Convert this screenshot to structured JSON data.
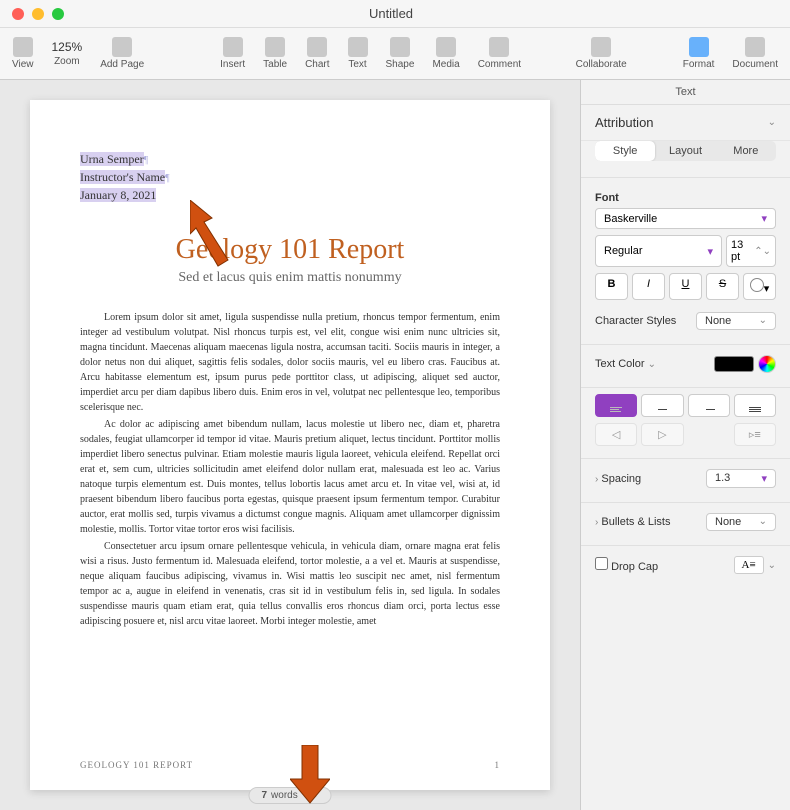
{
  "titlebar": {
    "title": "Untitled"
  },
  "toolbar": {
    "view": "View",
    "zoom": "Zoom",
    "zoom_val": "125%",
    "add_page": "Add Page",
    "insert": "Insert",
    "table": "Table",
    "chart": "Chart",
    "text": "Text",
    "shape": "Shape",
    "media": "Media",
    "comment": "Comment",
    "collaborate": "Collaborate",
    "format": "Format",
    "document": "Document"
  },
  "document": {
    "header": {
      "name": "Urna Semper",
      "instructor": "Instructor's Name",
      "date": "January 8, 2021"
    },
    "title": "Geology 101 Report",
    "subtitle": "Sed et lacus quis enim mattis nonummy",
    "para1": "Lorem ipsum dolor sit amet, ligula suspendisse nulla pretium, rhoncus tempor fermentum, enim integer ad vestibulum volutpat. Nisl rhoncus turpis est, vel elit, congue wisi enim nunc ultricies sit, magna tincidunt. Maecenas aliquam maecenas ligula nostra, accumsan taciti. Sociis mauris in integer, a dolor netus non dui aliquet, sagittis felis sodales, dolor sociis mauris, vel eu libero cras. Faucibus at. Arcu habitasse elementum est, ipsum purus pede porttitor class, ut adipiscing, aliquet sed auctor, imperdiet arcu per diam dapibus libero duis. Enim eros in vel, volutpat nec pellentesque leo, temporibus scelerisque nec.",
    "para2": "Ac dolor ac adipiscing amet bibendum nullam, lacus molestie ut libero nec, diam et, pharetra sodales, feugiat ullamcorper id tempor id vitae. Mauris pretium aliquet, lectus tincidunt. Porttitor mollis imperdiet libero senectus pulvinar. Etiam molestie mauris ligula laoreet, vehicula eleifend. Repellat orci erat et, sem cum, ultricies sollicitudin amet eleifend dolor nullam erat, malesuada est leo ac. Varius natoque turpis elementum est. Duis montes, tellus lobortis lacus amet arcu et. In vitae vel, wisi at, id praesent bibendum libero faucibus porta egestas, quisque praesent ipsum fermentum tempor. Curabitur auctor, erat mollis sed, turpis vivamus a dictumst congue magnis. Aliquam amet ullamcorper dignissim molestie, mollis. Tortor vitae tortor eros wisi facilisis.",
    "para3": "Consectetuer arcu ipsum ornare pellentesque vehicula, in vehicula diam, ornare magna erat felis wisi a risus. Justo fermentum id. Malesuada eleifend, tortor molestie, a a vel et. Mauris at suspendisse, neque aliquam faucibus adipiscing, vivamus in. Wisi mattis leo suscipit nec amet, nisl fermentum tempor ac a, augue in eleifend in venenatis, cras sit id in vestibulum felis in, sed ligula. In sodales suspendisse mauris quam etiam erat, quia tellus convallis eros rhoncus diam orci, porta lectus esse adipiscing posuere et, nisl arcu vitae laoreet. Morbi integer molestie, amet",
    "footer_left": "GEOLOGY 101 REPORT",
    "footer_right": "1"
  },
  "wordcount": {
    "num": "7",
    "label": " words"
  },
  "sidebar": {
    "tab": "Text",
    "attribution": "Attribution",
    "seg": {
      "style": "Style",
      "layout": "Layout",
      "more": "More"
    },
    "font": {
      "label": "Font",
      "family": "Baskerville",
      "weight": "Regular",
      "size": "13 pt"
    },
    "bius": {
      "b": "B",
      "i": "I",
      "u": "U",
      "s": "S"
    },
    "charstyles": {
      "label": "Character Styles",
      "value": "None"
    },
    "textcolor": "Text Color",
    "spacing": {
      "label": "Spacing",
      "value": "1.3"
    },
    "bullets": {
      "label": "Bullets & Lists",
      "value": "None"
    },
    "dropcap": {
      "label": "Drop Cap",
      "icon": "A"
    }
  }
}
